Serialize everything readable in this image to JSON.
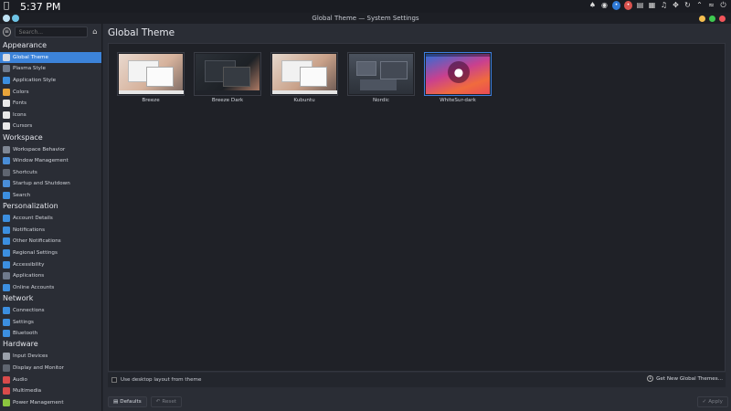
{
  "topbar": {
    "clock": "5:37 PM"
  },
  "window": {
    "title": "Global Theme — System Settings"
  },
  "sidebar": {
    "search_placeholder": "Search...",
    "categories": [
      {
        "label": "Appearance",
        "items": [
          {
            "label": "Global Theme",
            "icon": "global-theme-icon",
            "color": "#d9dde5",
            "active": true
          },
          {
            "label": "Plasma Style",
            "icon": "plasma-style-icon",
            "color": "#6f7a8c"
          },
          {
            "label": "Application Style",
            "icon": "application-style-icon",
            "color": "#3c8fe0"
          },
          {
            "label": "Colors",
            "icon": "colors-icon",
            "color": "#e8a43a"
          },
          {
            "label": "Fonts",
            "icon": "fonts-icon",
            "color": "#e9e9e9"
          },
          {
            "label": "Icons",
            "icon": "icons-icon",
            "color": "#e9e9e9"
          },
          {
            "label": "Cursors",
            "icon": "cursors-icon",
            "color": "#e9e9e9"
          }
        ]
      },
      {
        "label": "Workspace",
        "items": [
          {
            "label": "Workspace Behavior",
            "icon": "workspace-behavior-icon",
            "color": "#7f8794"
          },
          {
            "label": "Window Management",
            "icon": "window-management-icon",
            "color": "#4a8ed8"
          },
          {
            "label": "Shortcuts",
            "icon": "shortcuts-icon",
            "color": "#5f6570"
          },
          {
            "label": "Startup and Shutdown",
            "icon": "startup-shutdown-icon",
            "color": "#4a8ed8"
          },
          {
            "label": "Search",
            "icon": "search-icon",
            "color": "#3c8fe0"
          }
        ]
      },
      {
        "label": "Personalization",
        "items": [
          {
            "label": "Account Details",
            "icon": "account-details-icon",
            "color": "#3c8fe0"
          },
          {
            "label": "Notifications",
            "icon": "notifications-icon",
            "color": "#3c8fe0"
          },
          {
            "label": "Other Notifications",
            "icon": "other-notifications-icon",
            "color": "#3c8fe0"
          },
          {
            "label": "Regional Settings",
            "icon": "regional-settings-icon",
            "color": "#3c8fe0"
          },
          {
            "label": "Accessibility",
            "icon": "accessibility-icon",
            "color": "#3c8fe0"
          },
          {
            "label": "Applications",
            "icon": "applications-icon",
            "color": "#6f7a8c"
          },
          {
            "label": "Online Accounts",
            "icon": "online-accounts-icon",
            "color": "#3c8fe0"
          }
        ]
      },
      {
        "label": "Network",
        "items": [
          {
            "label": "Connections",
            "icon": "connections-icon",
            "color": "#3c8fe0"
          },
          {
            "label": "Settings",
            "icon": "network-settings-icon",
            "color": "#3c8fe0"
          },
          {
            "label": "Bluetooth",
            "icon": "bluetooth-icon",
            "color": "#3c8fe0"
          }
        ]
      },
      {
        "label": "Hardware",
        "items": [
          {
            "label": "Input Devices",
            "icon": "input-devices-icon",
            "color": "#9aa0aa"
          },
          {
            "label": "Display and Monitor",
            "icon": "display-monitor-icon",
            "color": "#5f6570"
          },
          {
            "label": "Audio",
            "icon": "audio-icon",
            "color": "#d94b4b"
          },
          {
            "label": "Multimedia",
            "icon": "multimedia-icon",
            "color": "#d94b4b"
          },
          {
            "label": "Power Management",
            "icon": "power-management-icon",
            "color": "#8cc63f"
          }
        ]
      }
    ]
  },
  "main": {
    "title": "Global Theme",
    "themes": [
      {
        "label": "Breeze",
        "style": "light",
        "selected": false
      },
      {
        "label": "Breeze Dark",
        "style": "dark",
        "selected": false
      },
      {
        "label": "Kubuntu",
        "style": "light",
        "selected": false
      },
      {
        "label": "Nordic",
        "style": "nordic",
        "selected": false
      },
      {
        "label": "WhiteSur-dark",
        "style": "whitesur",
        "selected": true
      }
    ],
    "use_desktop_layout": "Use desktop layout from theme",
    "get_new": "Get New Global Themes...",
    "defaults": "Defaults",
    "reset": "Reset",
    "apply": "Apply"
  },
  "colors": {
    "accent": "#3c83d9",
    "background": "#2a2d35",
    "panel": "#1f2127"
  }
}
